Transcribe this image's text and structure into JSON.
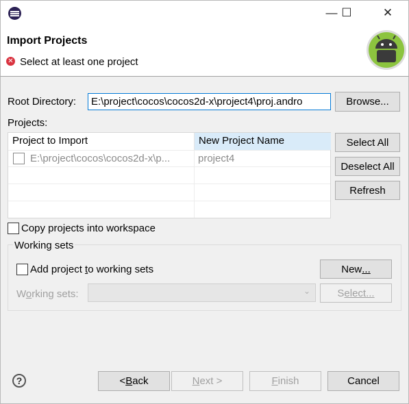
{
  "window": {
    "minimize_glyph": "—",
    "maximize_glyph": "☐",
    "close_glyph": "✕"
  },
  "header": {
    "title": "Import Projects",
    "error_message": "Select at least one project"
  },
  "root": {
    "label": "Root Directory:",
    "value": "E:\\project\\cocos\\cocos2d-x\\project4\\proj.andro",
    "browse_label": "Browse..."
  },
  "projects": {
    "label": "Projects:",
    "columns": [
      "Project to Import",
      "New Project Name"
    ],
    "rows": [
      {
        "checked": false,
        "project": "E:\\project\\cocos\\cocos2d-x\\p...",
        "new_name": "project4"
      }
    ],
    "select_all": "Select All",
    "deselect_all": "Deselect All",
    "refresh": "Refresh"
  },
  "copy_option": {
    "label": "Copy projects into workspace",
    "checked": false
  },
  "working_sets": {
    "title": "Working sets",
    "add_label_pre": "Add project ",
    "add_label_mn": "t",
    "add_label_post": "o working sets",
    "add_checked": false,
    "new_label_pre": "New",
    "new_label_mn": "...",
    "sets_label_pre": "W",
    "sets_label_mn": "o",
    "sets_label_post": "rking sets:",
    "select_label_pre": "S",
    "select_label_mn": "elect..."
  },
  "footer": {
    "back_pre": "< ",
    "back_mn": "B",
    "back_post": "ack",
    "next_mn": "N",
    "next_post": "ext >",
    "finish_mn": "F",
    "finish_post": "inish",
    "cancel": "Cancel"
  },
  "colors": {
    "accent": "#0078d7",
    "error": "#d9323f",
    "android_green": "#8cc43f"
  },
  "icons": {
    "app": "eclipse-icon",
    "error": "error-icon",
    "help": "help-icon",
    "logo": "android-logo"
  }
}
